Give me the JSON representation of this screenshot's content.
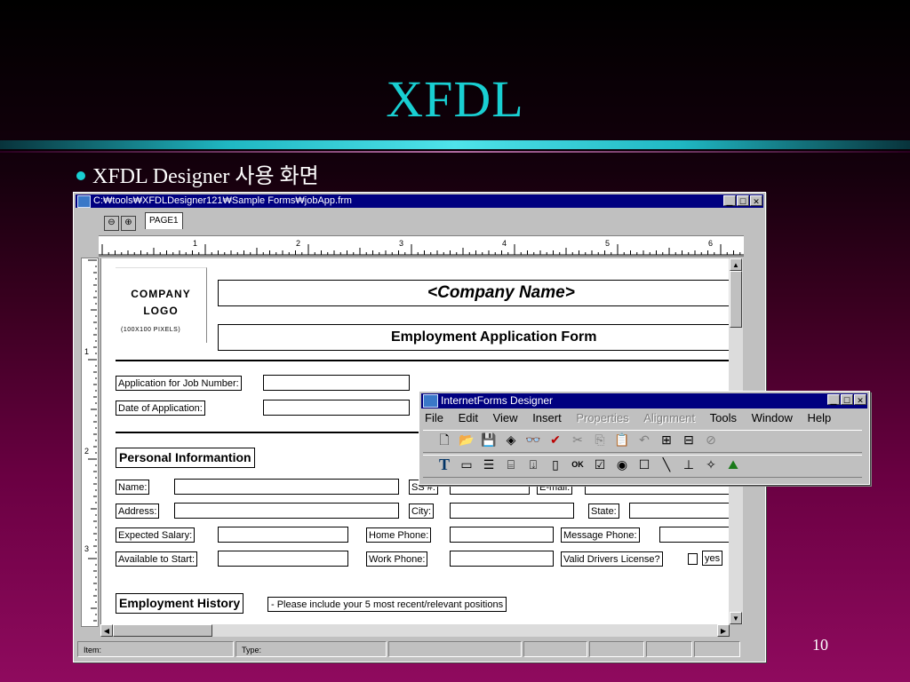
{
  "slide": {
    "title": "XFDL",
    "bullet": "XFDL Designer 사용 화면",
    "page_number": "10"
  },
  "designer": {
    "window_title": "C:₩tools₩XFDLDesigner121₩Sample Forms₩jobApp.frm",
    "page_tab": "PAGE1",
    "ruler_h": [
      "1",
      "2",
      "3",
      "4",
      "5",
      "6"
    ],
    "ruler_v": [
      "1",
      "2",
      "3"
    ],
    "status": {
      "item_label": "Item:",
      "type_label": "Type:"
    },
    "form": {
      "logo_line1": "COMPANY",
      "logo_line2": "LOGO",
      "logo_sub": "(100X100 PIXELS)",
      "company_name": "<Company Name>",
      "form_title": "Employment Application Form",
      "job_number_label": "Application for Job Number:",
      "date_label": "Date of Application:",
      "personal_section": "Personal Informantion",
      "name_label": "Name:",
      "ss_label": "SS #:",
      "email_label": "E-mail:",
      "address_label": "Address:",
      "city_label": "City:",
      "state_label": "State:",
      "salary_label": "Expected Salary:",
      "home_phone_label": "Home Phone:",
      "message_phone_label": "Message Phone:",
      "start_label": "Available to Start:",
      "work_phone_label": "Work Phone:",
      "license_label": "Valid Drivers License?",
      "license_value": "yes",
      "history_section": "Employment History",
      "history_note": "- Please include your 5 most recent/relevant positions"
    }
  },
  "toolbar_window": {
    "title": "InternetForms Designer",
    "menu": [
      {
        "label": "File",
        "enabled": true
      },
      {
        "label": "Edit",
        "enabled": true
      },
      {
        "label": "View",
        "enabled": true
      },
      {
        "label": "Insert",
        "enabled": true
      },
      {
        "label": "Properties",
        "enabled": false
      },
      {
        "label": "Alignment",
        "enabled": false
      },
      {
        "label": "Tools",
        "enabled": true
      },
      {
        "label": "Window",
        "enabled": true
      },
      {
        "label": "Help",
        "enabled": true
      }
    ],
    "row1_icons": [
      "new-icon",
      "open-icon",
      "save-icon",
      "publish-icon",
      "preview-icon",
      "spellcheck-icon",
      "cut-icon",
      "copy-icon",
      "paste-icon",
      "undo-icon",
      "add-page-icon",
      "remove-page-icon",
      "settings-icon"
    ],
    "row2_icons": [
      "text-tool-icon",
      "field-tool-icon",
      "list-tool-icon",
      "popup-tool-icon",
      "combo-tool-icon",
      "scroll-tool-icon",
      "button-tool-icon",
      "check-tool-icon",
      "radio-tool-icon",
      "box-tool-icon",
      "line-tool-icon",
      "spacer-tool-icon",
      "tag-tool-icon",
      "image-tool-icon"
    ],
    "row2_button_label": "OK"
  },
  "colors": {
    "title_cyan": "#19cfd2",
    "titlebar_blue": "#000080"
  }
}
